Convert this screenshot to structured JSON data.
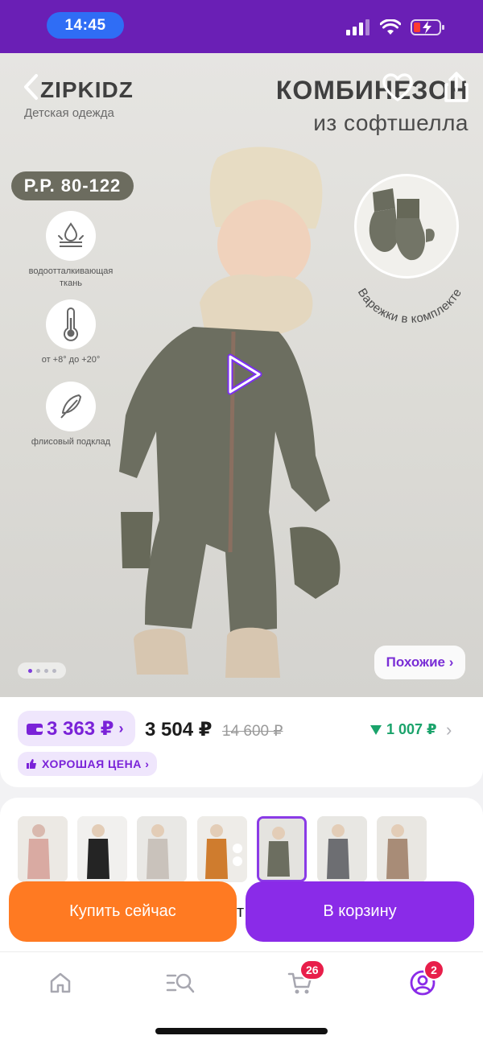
{
  "status_bar": {
    "time": "14:45"
  },
  "hero": {
    "brand_name": "ZIPKIDZ",
    "brand_sub": "Детская одежда",
    "headline_1": "КОМБИНЕЗОН",
    "headline_2": "из софтшелла",
    "size_badge": "Р.Р. 80-122",
    "features": [
      {
        "icon": "water-drop-icon",
        "label": "водоотталкивающая ткань"
      },
      {
        "icon": "thermometer-icon",
        "label": "от +8° до +20°"
      },
      {
        "icon": "feather-icon",
        "label": "флисовый подклад"
      }
    ],
    "mitten_caption": "Варежки в комплекте",
    "gallery": {
      "current": 1,
      "total": 4
    },
    "similar_label": "Похожие ›"
  },
  "price": {
    "wallet_amount": "3 363 ₽",
    "wallet_chevron": "›",
    "current": "3 504 ₽",
    "old": "14 600 ₽",
    "discount": "1 007 ₽",
    "good_price": "ХОРОШАЯ ЦЕНА ›"
  },
  "variants": {
    "selected_index": 4,
    "count": 7
  },
  "actions": {
    "buy_now": "Купить сейчас",
    "add_to_cart": "В корзину",
    "gap_letter": "т"
  },
  "nav": {
    "cart_badge": "26",
    "profile_badge": "2"
  },
  "colors": {
    "accent_purple": "#8a2be8",
    "buy_orange": "#ff7a22",
    "discount_green": "#1aa36b",
    "status_bar": "#6a1fb5"
  }
}
